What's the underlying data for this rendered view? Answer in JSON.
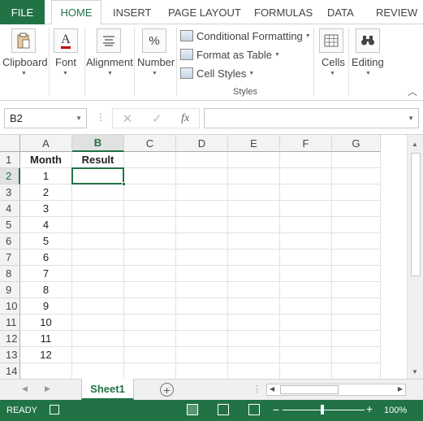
{
  "ribbon_tabs": {
    "file": "FILE",
    "home": "HOME",
    "insert": "INSERT",
    "page_layout": "PAGE LAYOUT",
    "formulas": "FORMULAS",
    "data": "DATA",
    "review": "REVIEW"
  },
  "ribbon_groups": {
    "clipboard": "Clipboard",
    "font": "Font",
    "alignment": "Alignment",
    "number": "Number",
    "number_symbol": "%",
    "font_symbol": "A",
    "conditional_formatting": "Conditional Formatting",
    "format_as_table": "Format as Table",
    "cell_styles": "Cell Styles",
    "styles_label": "Styles",
    "cells": "Cells",
    "editing": "Editing"
  },
  "formula_bar": {
    "name_box": "B2",
    "formula_value": "",
    "fx_label": "fx"
  },
  "sheet": {
    "columns": [
      "A",
      "B",
      "C",
      "D",
      "E",
      "F",
      "G"
    ],
    "selected_column": "B",
    "selected_row": "2",
    "row_numbers": [
      "1",
      "2",
      "3",
      "4",
      "5",
      "6",
      "7",
      "8",
      "9",
      "10",
      "11",
      "12",
      "13",
      "14"
    ],
    "header_row": {
      "A": "Month",
      "B": "Result"
    },
    "months": [
      "1",
      "2",
      "3",
      "4",
      "5",
      "6",
      "7",
      "8",
      "9",
      "10",
      "11",
      "12"
    ],
    "active_cell": "B2"
  },
  "sheet_tabs": {
    "active": "Sheet1"
  },
  "status_bar": {
    "status": "READY",
    "zoom": "100%",
    "zoom_level": 1.0
  },
  "colors": {
    "accent": "#217346"
  },
  "icons": {
    "clipboard": "paste-icon",
    "font": "font-color-icon",
    "alignment": "align-icon",
    "number": "percent-icon",
    "cells": "cells-icon",
    "editing": "binoculars-icon",
    "add_sheet": "plus-circle-icon"
  }
}
